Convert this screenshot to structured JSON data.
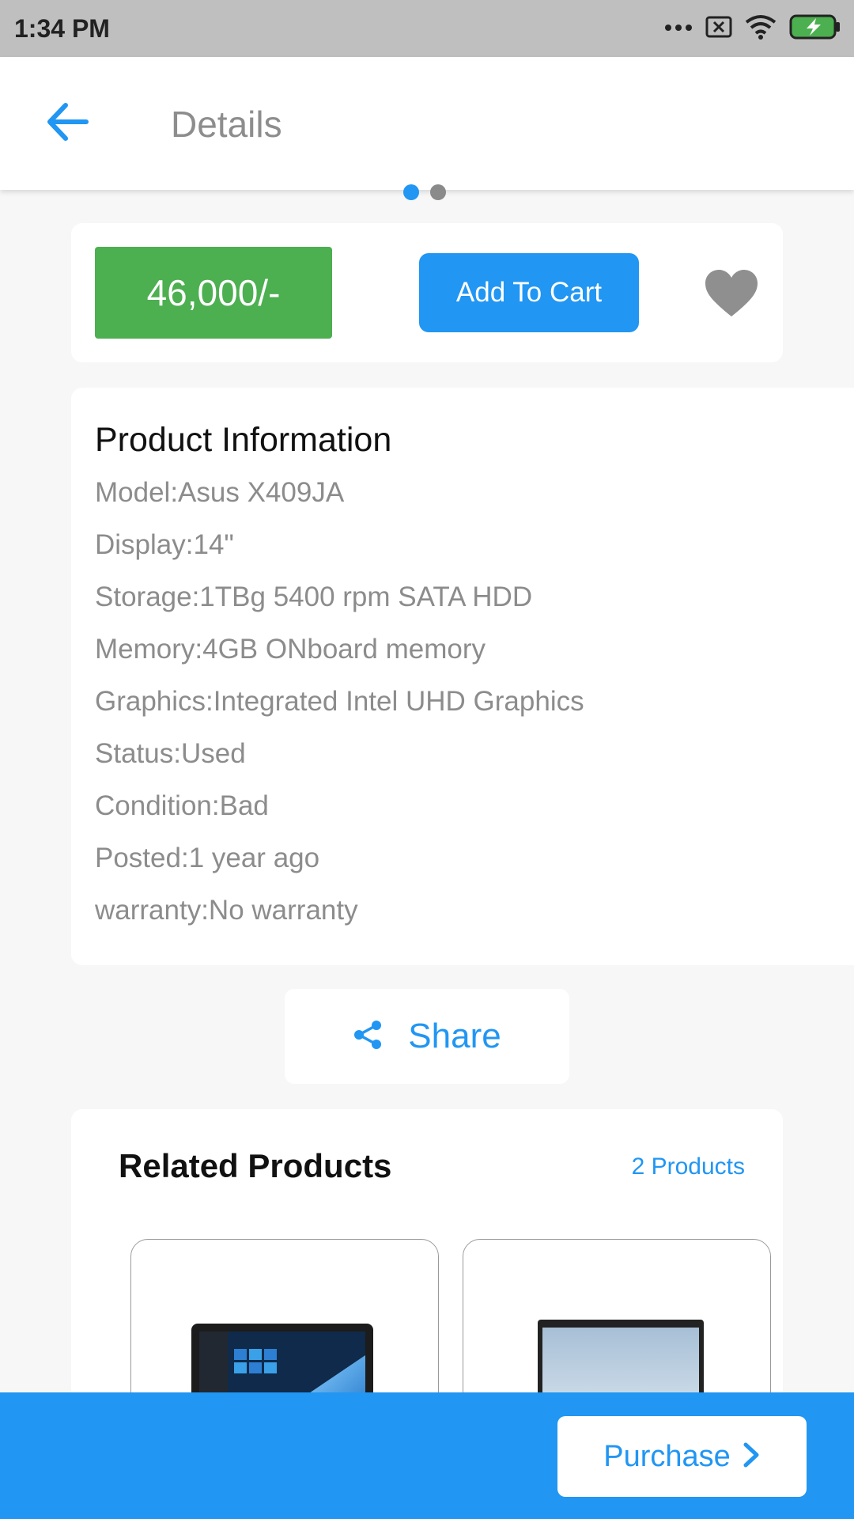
{
  "status_bar": {
    "time": "1:34 PM"
  },
  "app_bar": {
    "title": "Details"
  },
  "carousel": {
    "page_count": 2,
    "active_index": 0
  },
  "price_card": {
    "price": "46,000/-",
    "add_to_cart_label": "Add To Cart"
  },
  "product_info": {
    "title": "Product Information",
    "rows": [
      "Model:Asus X409JA",
      "Display:14\"",
      "Storage:1TBg 5400 rpm SATA HDD",
      "Memory:4GB ONboard memory",
      "Graphics:Integrated Intel UHD Graphics",
      "Status:Used",
      "Condition:Bad",
      "Posted:1 year ago",
      "warranty:No warranty"
    ]
  },
  "share": {
    "label": "Share"
  },
  "related": {
    "title": "Related Products",
    "count_label": "2 Products"
  },
  "bottom_bar": {
    "purchase_label": "Purchase"
  },
  "colors": {
    "accent": "#2196f3",
    "price": "#4caf50",
    "muted_text": "#8c8c8c",
    "status_bar": "#bfbfbf"
  },
  "icons": [
    "back-arrow-icon",
    "heart-icon",
    "share-icon",
    "chevron-right-icon",
    "wifi-icon",
    "battery-icon",
    "sim-off-icon"
  ]
}
